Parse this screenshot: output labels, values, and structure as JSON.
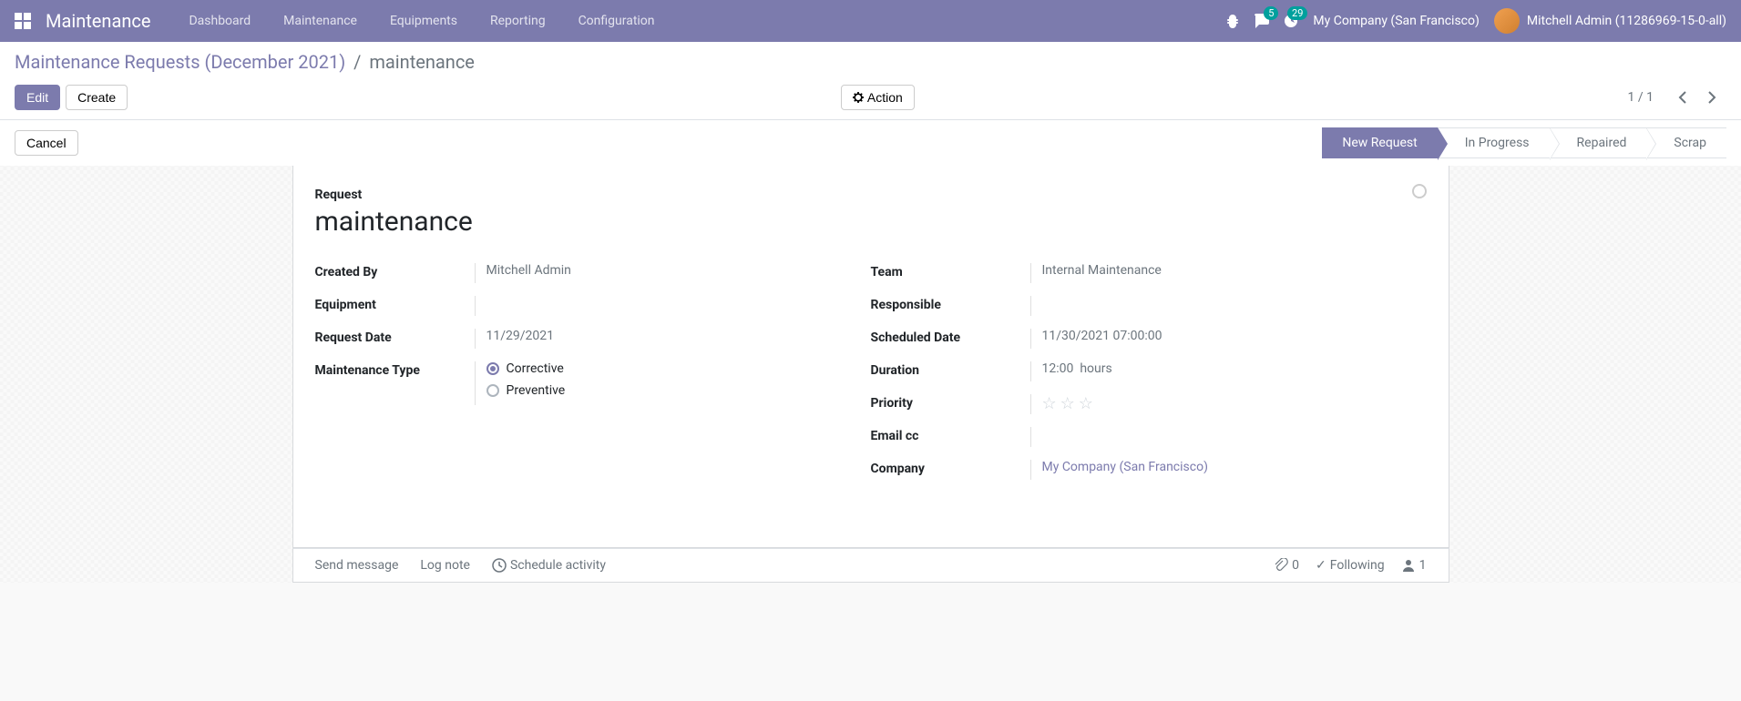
{
  "navbar": {
    "brand": "Maintenance",
    "menu": [
      "Dashboard",
      "Maintenance",
      "Equipments",
      "Reporting",
      "Configuration"
    ],
    "messages_badge": "5",
    "activities_badge": "29",
    "company": "My Company (San Francisco)",
    "user": "Mitchell Admin (11286969-15-0-all)"
  },
  "breadcrumb": {
    "parent": "Maintenance Requests (December 2021)",
    "current": "maintenance"
  },
  "toolbar": {
    "edit": "Edit",
    "create": "Create",
    "action": "Action",
    "cancel": "Cancel",
    "pager": "1 / 1"
  },
  "status": {
    "steps": [
      "New Request",
      "In Progress",
      "Repaired",
      "Scrap"
    ],
    "active": 0
  },
  "form": {
    "request_label": "Request",
    "title": "maintenance",
    "left": {
      "created_by_label": "Created By",
      "created_by": "Mitchell Admin",
      "equipment_label": "Equipment",
      "equipment": "",
      "request_date_label": "Request Date",
      "request_date": "11/29/2021",
      "maint_type_label": "Maintenance Type",
      "corrective": "Corrective",
      "preventive": "Preventive"
    },
    "right": {
      "team_label": "Team",
      "team": "Internal Maintenance",
      "responsible_label": "Responsible",
      "responsible": "",
      "scheduled_label": "Scheduled Date",
      "scheduled": "11/30/2021 07:00:00",
      "duration_label": "Duration",
      "duration_val": "12:00",
      "duration_unit": "hours",
      "priority_label": "Priority",
      "email_cc_label": "Email cc",
      "email_cc": "",
      "company_label": "Company",
      "company": "My Company (San Francisco)"
    }
  },
  "chatter": {
    "send": "Send message",
    "log": "Log note",
    "schedule": "Schedule activity",
    "attach_count": "0",
    "following": "Following",
    "followers": "1"
  }
}
